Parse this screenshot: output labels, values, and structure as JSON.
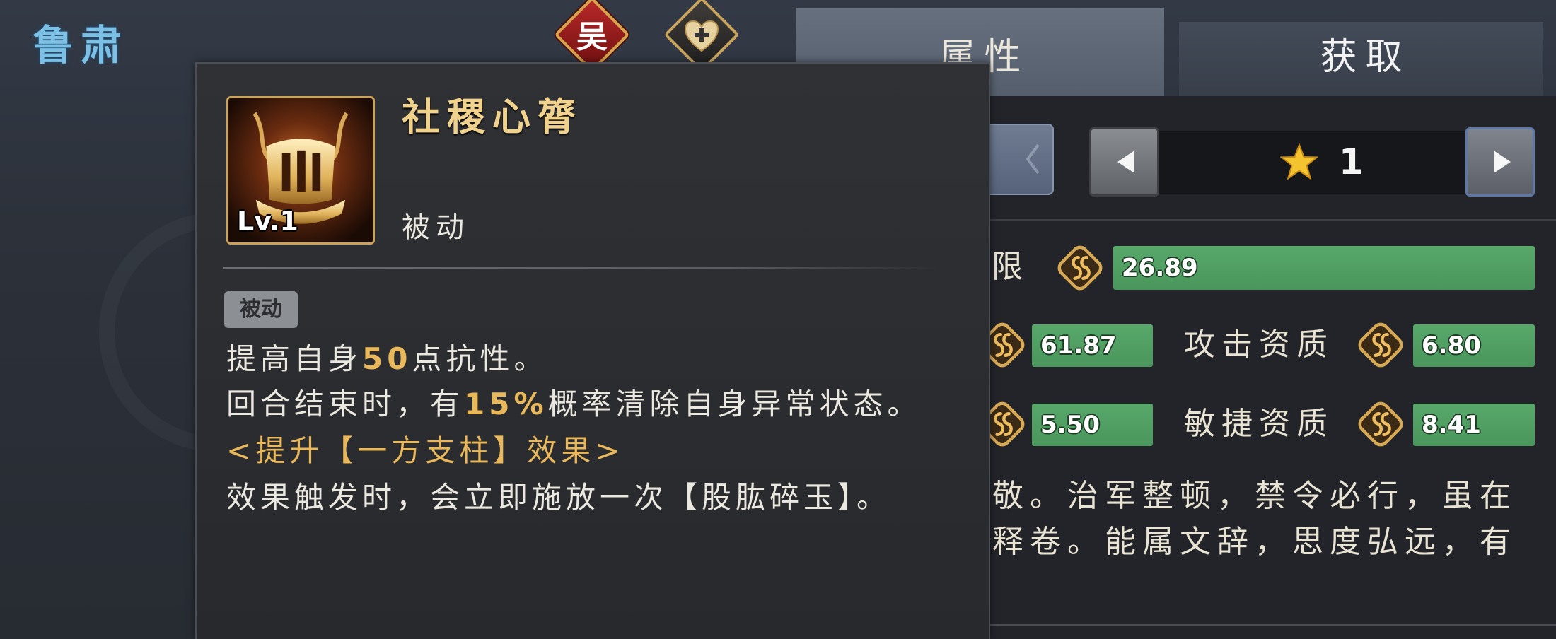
{
  "hero": {
    "name": "鲁肃",
    "faction": "吴"
  },
  "tabs": [
    {
      "label": "属性",
      "active": true
    },
    {
      "label": "获取",
      "active": false
    }
  ],
  "skill_tooltip": {
    "name": "社稷心膂",
    "level": "Lv.1",
    "type": "被动",
    "tag": "被动",
    "effect_1": {
      "before": "提高自身",
      "value": "50",
      "after": "点抗性。"
    },
    "effect_2": {
      "before": "回合结束时，有",
      "value": "15%",
      "after": "概率清除自身异常状态。"
    },
    "upgrade_heading": "<提升【一方支柱】效果>",
    "upgrade_effect": "效果触发时，会立即施放一次【股肱碎玉】。"
  },
  "star_selector": {
    "value": "1"
  },
  "attributes": {
    "row_1": {
      "label": "限",
      "value": "26.89"
    },
    "row_2": {
      "left_value": "61.87",
      "right_label": "攻击资质",
      "right_value": "6.80"
    },
    "row_3": {
      "left_value": "5.50",
      "right_label": "敏捷资质",
      "right_value": "8.41"
    }
  },
  "biography": [
    "敬。治军整顿，禁令必行，虽在",
    "释卷。能属文辞，思度弘远，有"
  ],
  "icons": {
    "faction": "faction-badge-icon",
    "favorite": "heart-plus-icon",
    "prev": "arrow-left-icon",
    "next": "arrow-right-icon",
    "star": "star-icon",
    "aptitude": "aptitude-badge-icon",
    "skill": "skill-throne-icon"
  },
  "colors": {
    "hero_name": "#7cc0e6",
    "highlight_gold": "#e9b85a",
    "value_bar_green": "#4a965c",
    "faction_red": "#b82828"
  }
}
